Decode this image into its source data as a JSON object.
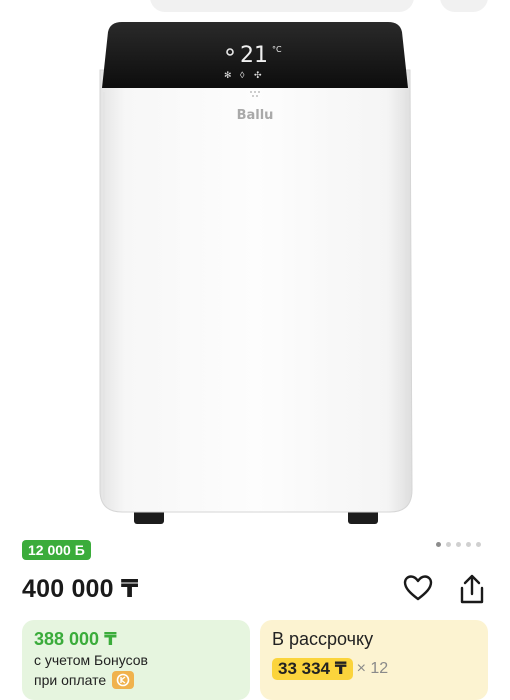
{
  "product": {
    "brand_logo": "Ballu",
    "display_temp": "21",
    "display_unit": "°C",
    "image_alt": "portable-air-conditioner"
  },
  "gallery": {
    "total_dots": 5,
    "active_index": 0
  },
  "points_badge": "12 000 Б",
  "price": "400 000 ₸",
  "bonus": {
    "price": "388 000 ₸",
    "line1": "с учетом Бонусов",
    "line2": "при оплате"
  },
  "installment": {
    "title": "В рассрочку",
    "amount": "33 334 ₸",
    "multiplier": "× 12"
  },
  "colors": {
    "green": "#3bac3b",
    "bonus_bg": "#e6f5df",
    "installment_bg": "#fcf3d1",
    "installment_highlight": "#fbd43c"
  },
  "icons": [
    "back-arrow-icon",
    "heart-icon",
    "share-icon",
    "kaspi-bonus-icon"
  ]
}
